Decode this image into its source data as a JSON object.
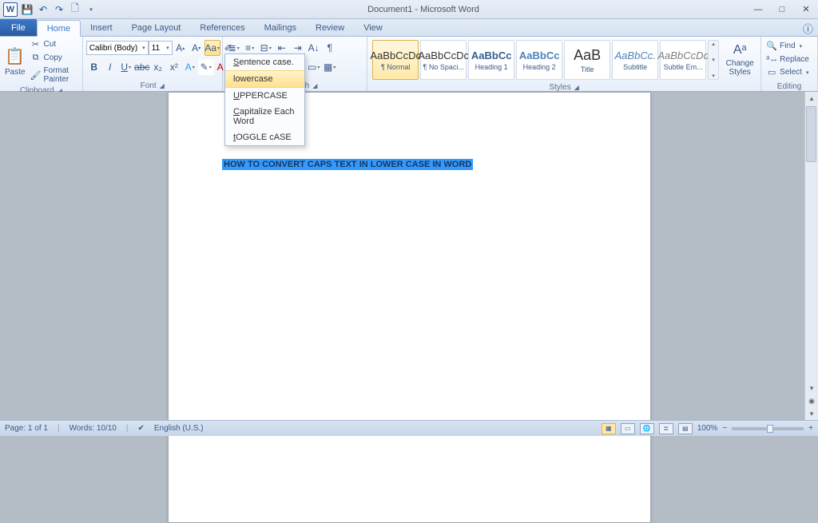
{
  "title": "Document1 - Microsoft Word",
  "qat": {
    "save": "💾",
    "undo": "↶",
    "redo": "↷",
    "new": "🗋"
  },
  "tabs": {
    "file": "File",
    "items": [
      "Home",
      "Insert",
      "Page Layout",
      "References",
      "Mailings",
      "Review",
      "View"
    ],
    "active": 0
  },
  "window_controls": {
    "min": "—",
    "max": "□",
    "close": "✕"
  },
  "clipboard": {
    "paste": "Paste",
    "cut": "Cut",
    "copy": "Copy",
    "format_painter": "Format Painter",
    "group": "Clipboard"
  },
  "font": {
    "name": "Calibri (Body)",
    "size": "11",
    "group": "Font"
  },
  "paragraph": {
    "group": "Paragraph"
  },
  "styles": {
    "items": [
      {
        "preview": "AaBbCcDc",
        "name": "¶ Normal"
      },
      {
        "preview": "AaBbCcDc",
        "name": "¶ No Spaci..."
      },
      {
        "preview": "AaBbCc",
        "name": "Heading 1"
      },
      {
        "preview": "AaBbCc",
        "name": "Heading 2"
      },
      {
        "preview": "AaB",
        "name": "Title"
      },
      {
        "preview": "AaBbCc.",
        "name": "Subtitle"
      },
      {
        "preview": "AaBbCcDc",
        "name": "Subtle Em..."
      }
    ],
    "change": "Change\nStyles",
    "group": "Styles"
  },
  "editing": {
    "find": "Find",
    "replace": "Replace",
    "select": "Select",
    "group": "Editing"
  },
  "change_case_menu": [
    "Sentence case.",
    "lowercase",
    "UPPERCASE",
    "Capitalize Each Word",
    "tOGGLE cASE"
  ],
  "document": {
    "selected_text": "HOW TO CONVERT CAPS TEXT IN LOWER CASE IN WORD"
  },
  "statusbar": {
    "page": "Page: 1 of 1",
    "words": "Words: 10/10",
    "lang": "English (U.S.)",
    "zoom": "100%"
  }
}
